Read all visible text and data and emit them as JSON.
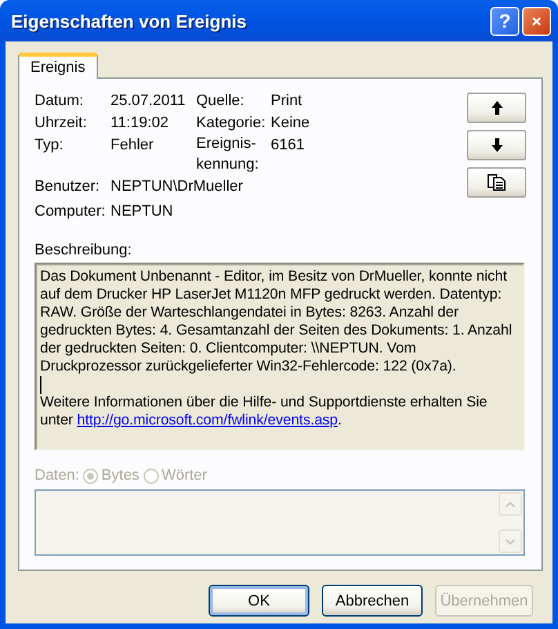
{
  "window": {
    "title": "Eigenschaften von Ereignis",
    "help_button": "?"
  },
  "tabs": [
    {
      "label": "Ereignis",
      "selected": true
    }
  ],
  "fields": [
    [
      {
        "label": "Datum:",
        "value": "25.07.2011"
      },
      {
        "label": "Quelle:",
        "value": "Print"
      }
    ],
    [
      {
        "label": "Uhrzeit:",
        "value": "11:19:02"
      },
      {
        "label": "Kategorie:",
        "value": "Keine"
      }
    ],
    [
      {
        "label": "Typ:",
        "value": "Fehler"
      },
      {
        "label": "Ereignis-kennung:",
        "value": "6161"
      }
    ],
    [
      {
        "label": "Benutzer:",
        "value": "NEPTUN\\DrMueller"
      }
    ],
    [
      {
        "label": "Computer:",
        "value": "NEPTUN"
      }
    ]
  ],
  "description": {
    "label": "Beschreibung:",
    "paragraph_lines": [
      "Das Dokument Unbenannt - Editor, im Besitz von DrMueller, konnte nicht",
      "auf dem Drucker HP LaserJet M1120n MFP gedruckt werden. Datentyp:",
      "RAW. Größe der Warteschlangendatei in Bytes: 8263. Anzahl der",
      "gedruckten Bytes: 4. Gesamtanzahl der Seiten des Dokuments: 1. Anzahl",
      "der gedruckten Seiten: 0. Clientcomputer: \\\\NEPTUN. Vom",
      "Druckprozessor zurückgelieferter Win32-Fehlercode: 122 (0x7a)."
    ],
    "info_line": "Weitere Informationen über die Hilfe- und Supportdienste erhalten Sie",
    "link_prefix": "unter",
    "link": "http://go.microsoft.com/fwlink/events.asp",
    "link_suffix": "."
  },
  "data": {
    "label": "Daten:",
    "disabled": true,
    "options": [
      {
        "label": "Bytes",
        "selected": true
      },
      {
        "label": "Wörter",
        "selected": false
      }
    ]
  },
  "buttons": [
    {
      "label": "OK",
      "default": true,
      "disabled": false
    },
    {
      "label": "Abbrechen",
      "default": false,
      "disabled": false
    },
    {
      "label": "Übernehmen",
      "default": false,
      "disabled": true
    }
  ]
}
